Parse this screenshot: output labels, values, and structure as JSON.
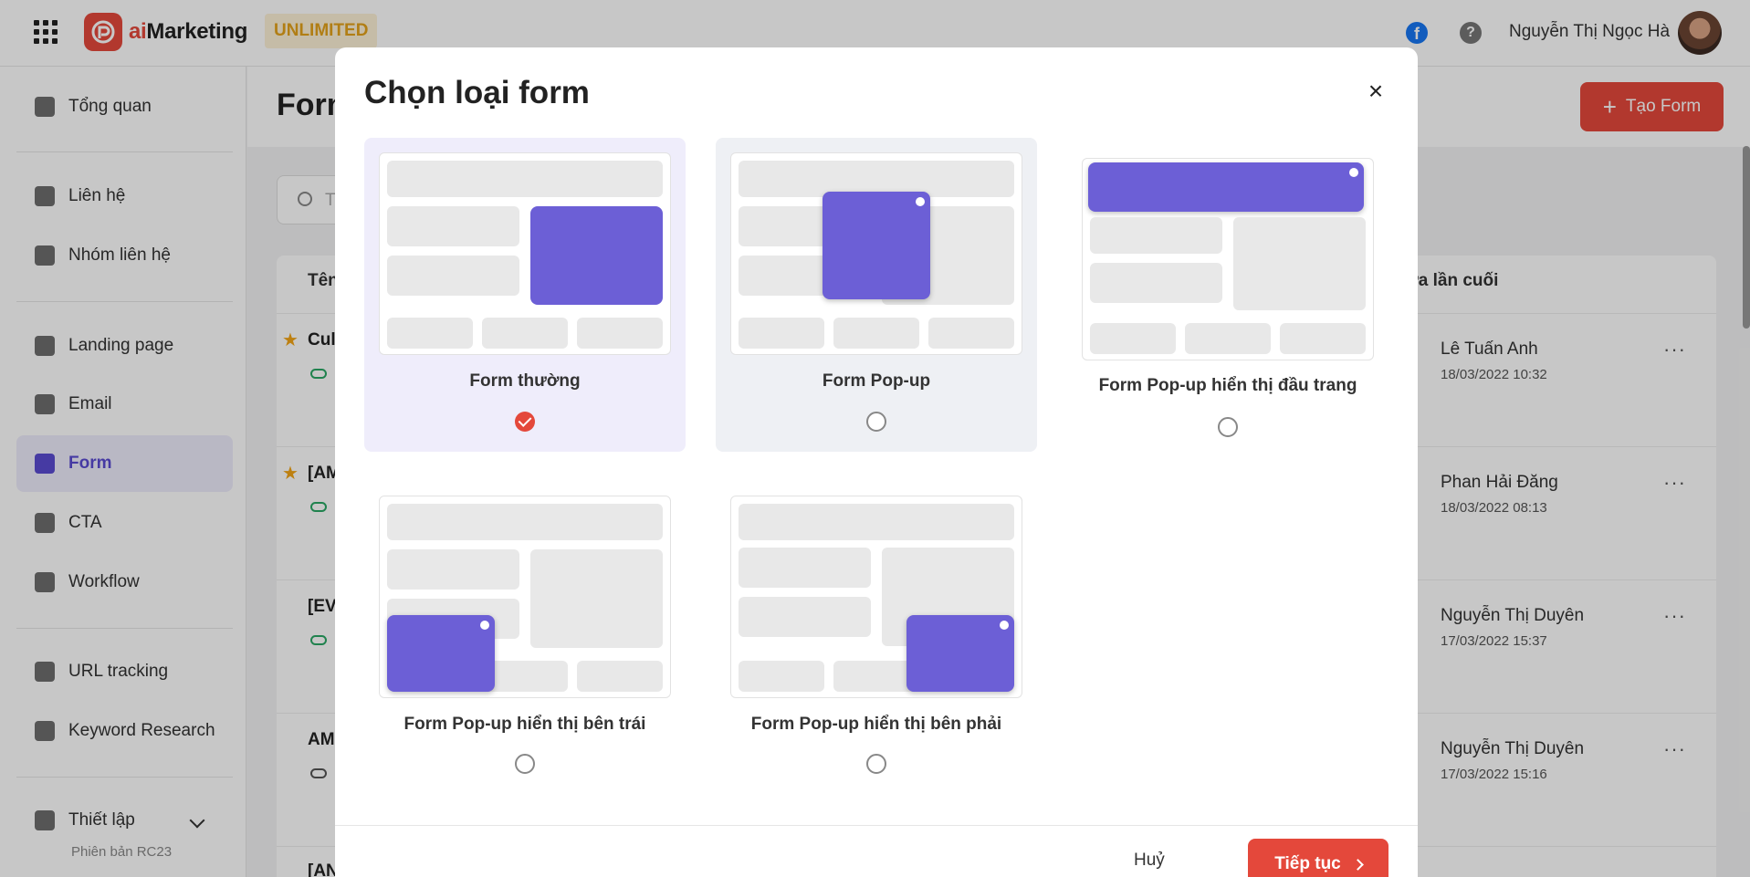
{
  "app": {
    "name_prefix": "ai",
    "name_suffix": "Marketing",
    "plan_badge": "UNLIMITED"
  },
  "header": {
    "user_name": "Nguyễn Thị Ngọc Hà"
  },
  "sidebar": {
    "items": [
      {
        "label": "Tổng quan",
        "icon": "chart-icon"
      },
      {
        "label": "Liên hệ",
        "icon": "contacts-icon"
      },
      {
        "label": "Nhóm liên hệ",
        "icon": "contact-group-icon"
      },
      {
        "label": "Landing page",
        "icon": "landing-icon"
      },
      {
        "label": "Email",
        "icon": "email-icon"
      },
      {
        "label": "Form",
        "icon": "form-icon",
        "active": true
      },
      {
        "label": "CTA",
        "icon": "cta-icon"
      },
      {
        "label": "Workflow",
        "icon": "workflow-icon"
      },
      {
        "label": "URL tracking",
        "icon": "link-icon"
      },
      {
        "label": "Keyword Research",
        "icon": "keyword-icon"
      },
      {
        "label": "Thiết lập",
        "icon": "settings-icon"
      }
    ],
    "version": "Phiên bản RC23"
  },
  "page": {
    "title": "Form",
    "create_button": "Tạo Form",
    "search_placeholder": "T",
    "columns": {
      "name": "Tên",
      "last_edit": "ửa lần cuối"
    },
    "rows": [
      {
        "name": "Cul",
        "user": "Lê Tuấn Anh",
        "time": "18/03/2022 10:32",
        "starred": true
      },
      {
        "name": "[AM",
        "user": "Phan Hải Đăng",
        "time": "18/03/2022 08:13",
        "starred": true
      },
      {
        "name": "[EV",
        "user": "Nguyễn Thị Duyên",
        "time": "17/03/2022 15:37",
        "starred": false
      },
      {
        "name": "AM",
        "user": "Nguyễn Thị Duyên",
        "time": "17/03/2022 15:16",
        "starred": false
      },
      {
        "name": "[AN",
        "user": "",
        "time": "",
        "starred": false
      }
    ]
  },
  "modal": {
    "title": "Chọn loại form",
    "options": [
      {
        "label": "Form thường",
        "selected": true
      },
      {
        "label": "Form Pop-up",
        "selected": false
      },
      {
        "label": "Form Pop-up hiển thị đầu trang",
        "selected": false
      },
      {
        "label": "Form Pop-up hiển thị bên trái",
        "selected": false
      },
      {
        "label": "Form Pop-up hiển thị bên phải",
        "selected": false
      }
    ],
    "cancel_label": "Huỷ",
    "continue_label": "Tiếp tục"
  },
  "colors": {
    "accent": "#e4483b",
    "purple": "#6c5fd6",
    "badge": "#e3a21a"
  }
}
